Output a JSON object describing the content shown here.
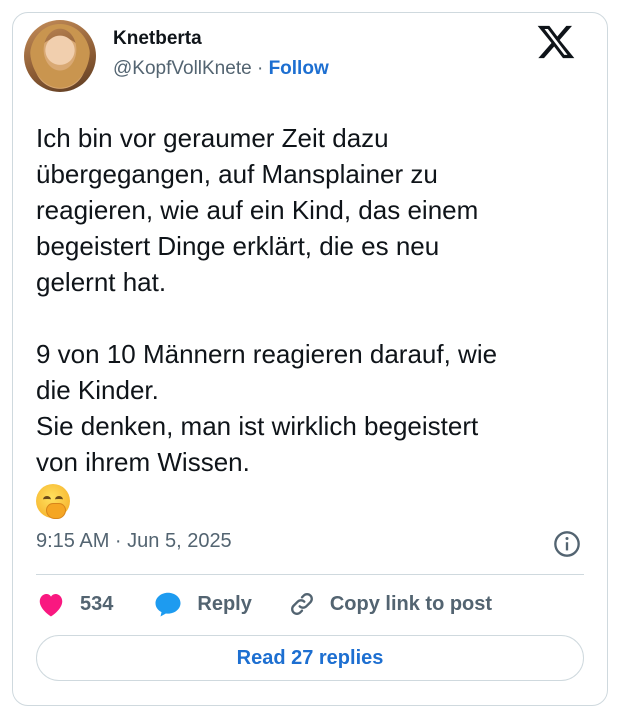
{
  "author": {
    "name": "Knetberta",
    "handle": "@KopfVollKnete",
    "separator": "·",
    "follow_label": "Follow"
  },
  "tweet": {
    "paragraph1": [
      "Ich bin vor geraumer Zeit dazu",
      "übergegangen, auf Mansplainer zu",
      "reagieren, wie auf ein Kind, das einem",
      "begeistert Dinge erklärt, die es neu",
      "gelernt hat."
    ],
    "paragraph2": [
      "9 von 10 Männern reagieren darauf, wie",
      "die Kinder.",
      "Sie denken, man ist wirklich begeistert",
      "von ihrem Wissen."
    ],
    "emoji": "face-with-hand-over-mouth",
    "timestamp": "9:15 AM · Jun 5, 2025"
  },
  "actions": {
    "like_count": "534",
    "reply_label": "Reply",
    "copy_link_label": "Copy link to post"
  },
  "read_replies_label": "Read 27 replies",
  "colors": {
    "accent_blue": "#1d6fd1",
    "heart_red": "#f91880",
    "reply_bubble_blue": "#1d9bf0",
    "text_gray": "#536471",
    "border": "#cfd9de"
  }
}
